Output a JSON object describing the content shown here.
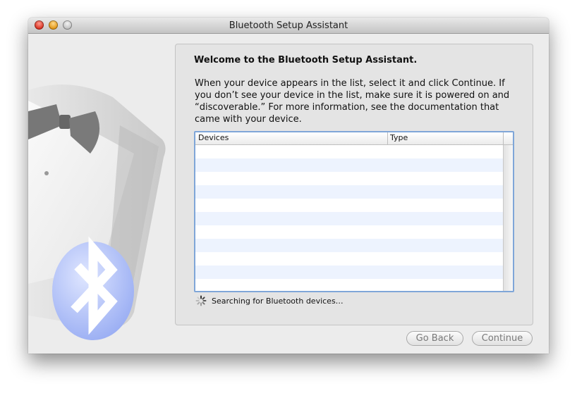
{
  "window": {
    "title": "Bluetooth Setup Assistant"
  },
  "panel": {
    "heading": "Welcome to the Bluetooth Setup Assistant.",
    "description": "When your device appears in the list, select it and click Continue. If you don’t see your device in the list, make sure it is powered on and “discoverable.” For more information, see the documentation that came with your device."
  },
  "table": {
    "columns": [
      "Devices",
      "Type"
    ],
    "rows": []
  },
  "status": {
    "text": "Searching for Bluetooth devices…"
  },
  "buttons": {
    "back": "Go Back",
    "continue": "Continue"
  },
  "icons": {
    "illustration": "tuxedo-bluetooth-illustration",
    "spinner": "spinner-icon",
    "bluetooth": "bluetooth-icon"
  },
  "colors": {
    "accent": "#7fa6d8",
    "bluetooth": "#9fb3f5"
  }
}
